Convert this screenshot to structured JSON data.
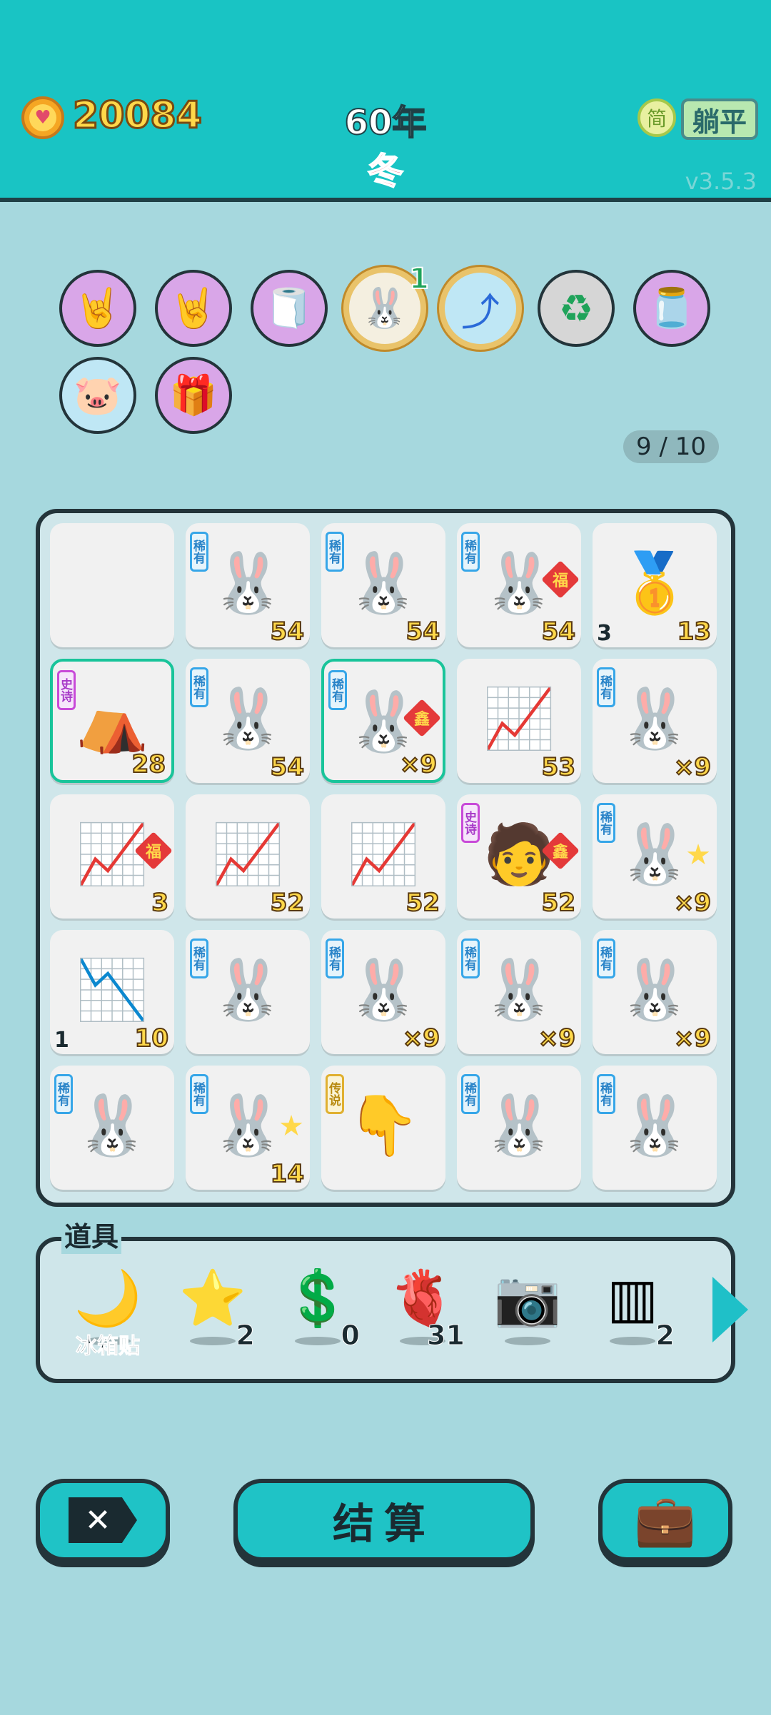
{
  "header": {
    "coins": "20084",
    "year": "60年",
    "season": "冬",
    "simplified_label": "简",
    "lie_flat_label": "躺平",
    "version": "v3.5.3"
  },
  "relics": [
    {
      "name": "rock-hand-icon",
      "glyph": "🤘"
    },
    {
      "name": "rock-hand-icon",
      "glyph": "🤘"
    },
    {
      "name": "tissue-box-icon",
      "glyph": "🧻"
    },
    {
      "name": "rabbit-relic-icon",
      "glyph": "🐰",
      "count": "1"
    },
    {
      "name": "upgrade-arrow-icon",
      "glyph": "⤴"
    },
    {
      "name": "refresh-icon",
      "glyph": "♻"
    },
    {
      "name": "jar-icon",
      "glyph": "🫙"
    },
    {
      "name": "piggy-bank-icon",
      "glyph": "🐷"
    },
    {
      "name": "gift-box-icon",
      "glyph": "🎁"
    }
  ],
  "slots": "9 / 10",
  "board": [
    [
      {
        "empty": true
      },
      {
        "tag": "稀有",
        "glyph": "🐰",
        "val": "54"
      },
      {
        "tag": "稀有",
        "glyph": "🐰",
        "val": "54"
      },
      {
        "tag": "稀有",
        "glyph": "🐰",
        "val": "54",
        "badge": "福"
      },
      {
        "glyph": "🥇",
        "val": "13",
        "ld": "3"
      }
    ],
    [
      {
        "tag": "史诗",
        "glyph": "⛺",
        "val": "28",
        "hl": true
      },
      {
        "tag": "稀有",
        "glyph": "🐰",
        "val": "54"
      },
      {
        "tag": "稀有",
        "glyph": "🐰",
        "val": "×9",
        "badge": "鑫",
        "hl": true
      },
      {
        "glyph": "📈",
        "val": "53"
      },
      {
        "tag": "稀有",
        "glyph": "🐰",
        "val": "×9"
      }
    ],
    [
      {
        "glyph": "📈",
        "val": "3",
        "badge": "福"
      },
      {
        "glyph": "📈",
        "val": "52"
      },
      {
        "glyph": "📈",
        "val": "52"
      },
      {
        "tag": "史诗",
        "glyph": "🧑",
        "val": "52",
        "badge": "鑫"
      },
      {
        "tag": "稀有",
        "glyph": "🐰",
        "val": "×9",
        "star": true
      }
    ],
    [
      {
        "glyph": "📉",
        "val": "10",
        "ld": "1"
      },
      {
        "tag": "稀有",
        "glyph": "🐰",
        "val": ""
      },
      {
        "tag": "稀有",
        "glyph": "🐰",
        "val": "×9"
      },
      {
        "tag": "稀有",
        "glyph": "🐰",
        "val": "×9"
      },
      {
        "tag": "稀有",
        "glyph": "🐰",
        "val": "×9"
      }
    ],
    [
      {
        "tag": "稀有",
        "glyph": "🐰",
        "val": ""
      },
      {
        "tag": "稀有",
        "glyph": "🐰",
        "val": "14",
        "star": true
      },
      {
        "tag": "传说",
        "glyph": "👇",
        "val": "",
        "leg": true
      },
      {
        "tag": "稀有",
        "glyph": "🐰",
        "val": ""
      },
      {
        "tag": "稀有",
        "glyph": "🐰",
        "val": ""
      }
    ]
  ],
  "items": {
    "title": "道具",
    "list": [
      {
        "name": "fridge-magnet-item",
        "glyph": "🌙",
        "label": "冰箱贴"
      },
      {
        "name": "star-item",
        "glyph": "⭐",
        "count": "2"
      },
      {
        "name": "coin-item",
        "glyph": "💲",
        "count": "0"
      },
      {
        "name": "liver-item",
        "glyph": "🫀",
        "count": "31"
      },
      {
        "name": "camera-item",
        "glyph": "📷",
        "count": ""
      },
      {
        "name": "slot-frame-item",
        "glyph": "▥",
        "count": "2"
      }
    ]
  },
  "buttons": {
    "delete": "✕",
    "settle": "结算",
    "bag": "💼"
  },
  "colors": {
    "header_bg": "#19c4c4",
    "page_bg": "#a6d8de",
    "button_bg": "#1fc3c6"
  }
}
